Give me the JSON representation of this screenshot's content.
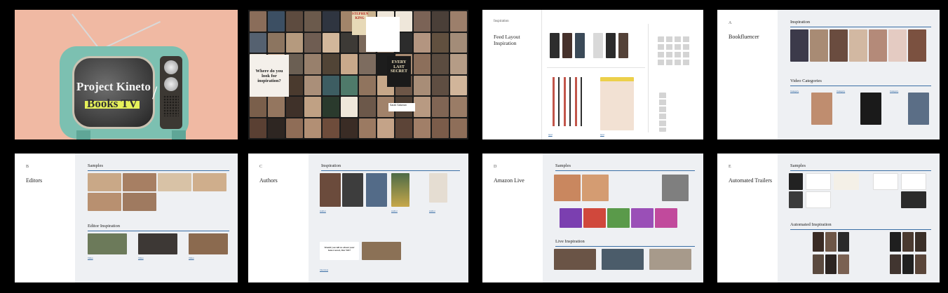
{
  "slides": {
    "title": {
      "brand": "",
      "line1": "Project Kineto",
      "line2": "Books TV",
      "subtitle": ""
    },
    "inspiration_collage": {
      "question": "Where do you look for inspiration?",
      "stephen_king": "STEPHEN KING",
      "every_cover": "EVERY LAST SECRET",
      "stephen_note": "",
      "sarah": "Sarah Salsman"
    },
    "feed_layout": {
      "section": "Inspiration",
      "small": "",
      "title": "Feed Layout Inspiration",
      "desc": "",
      "top_label": ""
    },
    "bookfluencer": {
      "letter": "A",
      "small": "",
      "title": "Bookfluencer",
      "desc": "",
      "inspiration": "Inspiration",
      "video_categories": "Video Categories"
    },
    "editors": {
      "letter": "B",
      "small": "",
      "title": "Editors",
      "desc": "",
      "samples": "Samples",
      "editor_inspiration": "Editor Inspiration"
    },
    "authors": {
      "letter": "C",
      "small": "",
      "title": "Authors",
      "desc": "",
      "inspiration": "Inspiration",
      "question": "Would you tell us about your latest novel, Jim Wil?"
    },
    "amazon_live": {
      "letter": "D",
      "small": "",
      "title": "Amazon Live",
      "desc": "",
      "samples": "Samples",
      "live_inspiration": "Live Inspiration"
    },
    "trailers": {
      "letter": "E",
      "small": "",
      "title": "Automated Trailers",
      "desc": "",
      "samples": "Samples",
      "automated_inspiration": "Automated Inspiration"
    }
  },
  "colors": {
    "accent_rule": "#3a6ea5",
    "title_bg": "#f0b9a3",
    "tv_body": "#7cc0b1",
    "highlight": "#e6f15a"
  }
}
